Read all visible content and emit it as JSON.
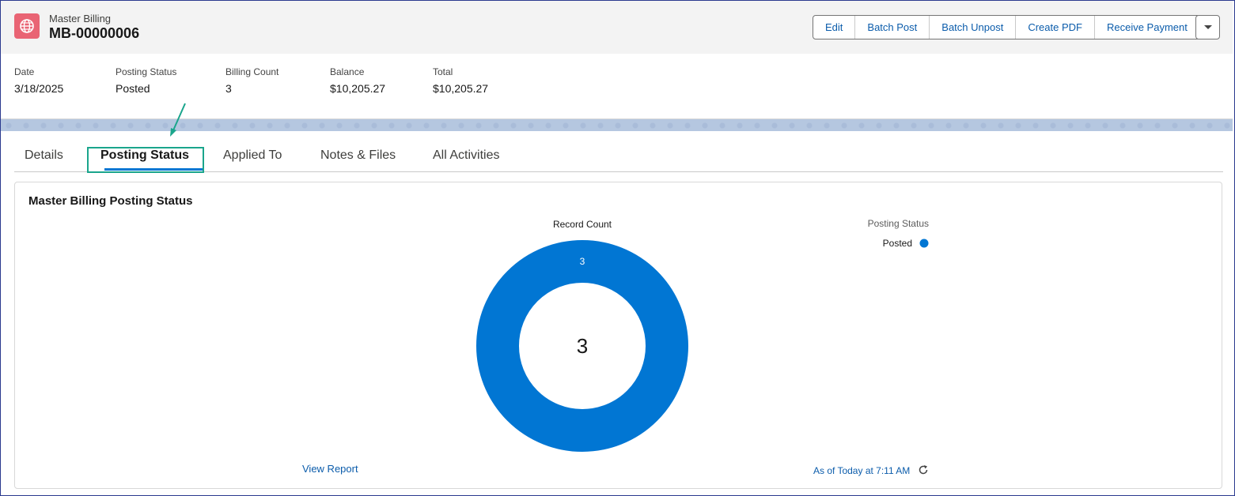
{
  "record": {
    "object_type": "Master Billing",
    "name": "MB-00000006",
    "icon": "globe-icon",
    "icon_color": "#e96474"
  },
  "actions": [
    {
      "label": "Edit"
    },
    {
      "label": "Batch Post"
    },
    {
      "label": "Batch Unpost"
    },
    {
      "label": "Create PDF"
    },
    {
      "label": "Receive Payment"
    }
  ],
  "highlights": [
    {
      "label": "Date",
      "value": "3/18/2025"
    },
    {
      "label": "Posting Status",
      "value": "Posted"
    },
    {
      "label": "Billing Count",
      "value": "3"
    },
    {
      "label": "Balance",
      "value": "$10,205.27"
    },
    {
      "label": "Total",
      "value": "$10,205.27"
    }
  ],
  "tabs": [
    {
      "label": "Details"
    },
    {
      "label": "Posting Status",
      "active": true
    },
    {
      "label": "Applied To"
    },
    {
      "label": "Notes & Files"
    },
    {
      "label": "All Activities"
    }
  ],
  "card": {
    "title": "Master Billing Posting Status",
    "view_report": "View Report",
    "as_of": "As of Today at 7:11 AM"
  },
  "chart_data": {
    "type": "pie",
    "donut": true,
    "title": "Record Count",
    "center_label": "3",
    "legend_title": "Posting Status",
    "legend_placement": "right",
    "categories": [
      "Posted"
    ],
    "values": [
      3
    ],
    "colors": [
      "#0176d3"
    ]
  },
  "colors": {
    "accent": "#0176d3",
    "link": "#0b5cab",
    "annotation": "#1aa58c"
  }
}
